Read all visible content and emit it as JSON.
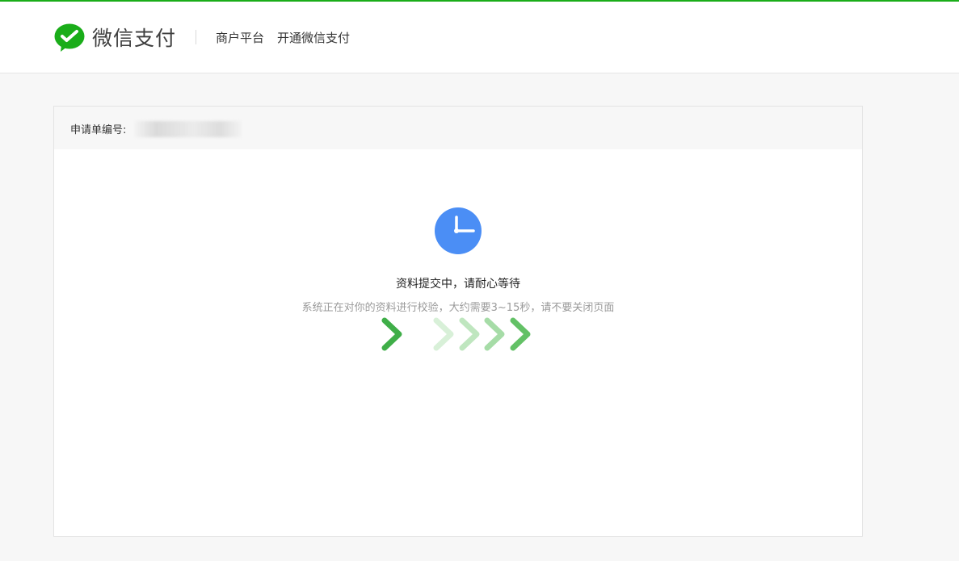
{
  "header": {
    "brand_name": "微信支付",
    "nav": [
      "商户平台",
      "开通微信支付"
    ]
  },
  "order": {
    "label": "申请单编号:",
    "value": ""
  },
  "status": {
    "title": "资料提交中，请耐心等待",
    "description": "系统正在对你的资料进行校验，大约需要3~15秒，请不要关闭页面"
  },
  "icons": {
    "logo": "wechat-pay-logo-icon",
    "status": "clock-icon",
    "progress": "chevron-right-icon"
  },
  "colors": {
    "accent": "#1aad19",
    "clock": "#4b8ef5",
    "chevron_dark": "#3fae48",
    "chevron_light": "#c8ebc8"
  }
}
